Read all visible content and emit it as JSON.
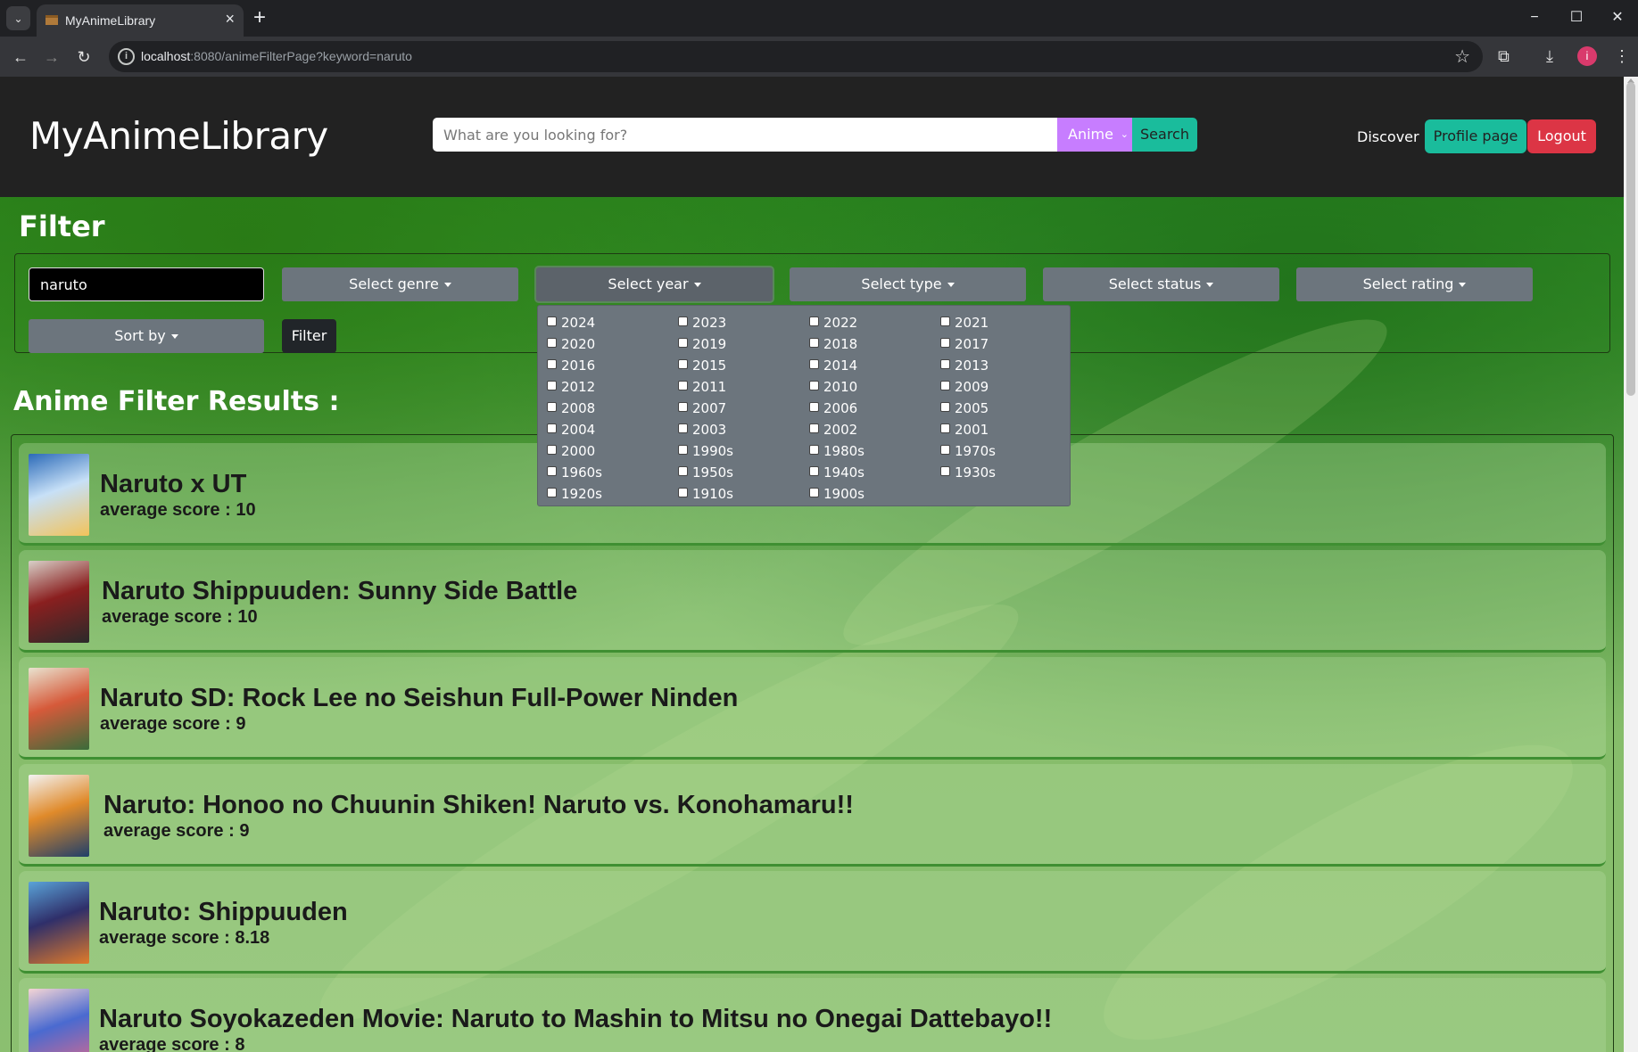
{
  "browser": {
    "tab_title": "MyAnimeLibrary",
    "url_host": "localhost",
    "url_rest": ":8080/animeFilterPage?keyword=naruto"
  },
  "navbar": {
    "brand": "MyAnimeLibrary",
    "search_placeholder": "What are you looking for?",
    "search_type": "Anime",
    "search_button": "Search",
    "discover": "Discover",
    "profile": "Profile page",
    "logout": "Logout"
  },
  "filter": {
    "title": "Filter",
    "keyword": "naruto",
    "genre": "Select genre",
    "year": "Select year",
    "type": "Select type",
    "status": "Select status",
    "rating": "Select rating",
    "sort": "Sort by",
    "submit": "Filter",
    "year_options": [
      "2024",
      "2023",
      "2022",
      "2021",
      "2020",
      "2019",
      "2018",
      "2017",
      "2016",
      "2015",
      "2014",
      "2013",
      "2012",
      "2011",
      "2010",
      "2009",
      "2008",
      "2007",
      "2006",
      "2005",
      "2004",
      "2003",
      "2002",
      "2001",
      "2000",
      "1990s",
      "1980s",
      "1970s",
      "1960s",
      "1950s",
      "1940s",
      "1930s",
      "1920s",
      "1910s",
      "1900s"
    ]
  },
  "results": {
    "title": "Anime Filter Results :",
    "items": [
      {
        "title": "Naruto x UT",
        "score": "average score : 10"
      },
      {
        "title": "Naruto Shippuuden: Sunny Side Battle",
        "score": "average score : 10"
      },
      {
        "title": "Naruto SD: Rock Lee no Seishun Full-Power Ninden",
        "score": "average score : 9"
      },
      {
        "title": "Naruto: Honoo no Chuunin Shiken! Naruto vs. Konohamaru!!",
        "score": "average score : 9"
      },
      {
        "title": "Naruto: Shippuuden",
        "score": "average score : 8.18"
      },
      {
        "title": "Naruto Soyokazeden Movie: Naruto to Mashin to Mitsu no Onegai Dattebayo!!",
        "score": "average score : 8"
      }
    ]
  },
  "colors": {
    "accent_teal": "#1abc9c",
    "logout_red": "#dc3545",
    "search_type_purple": "#c77dff",
    "dropdown_gray": "#6c757d"
  }
}
